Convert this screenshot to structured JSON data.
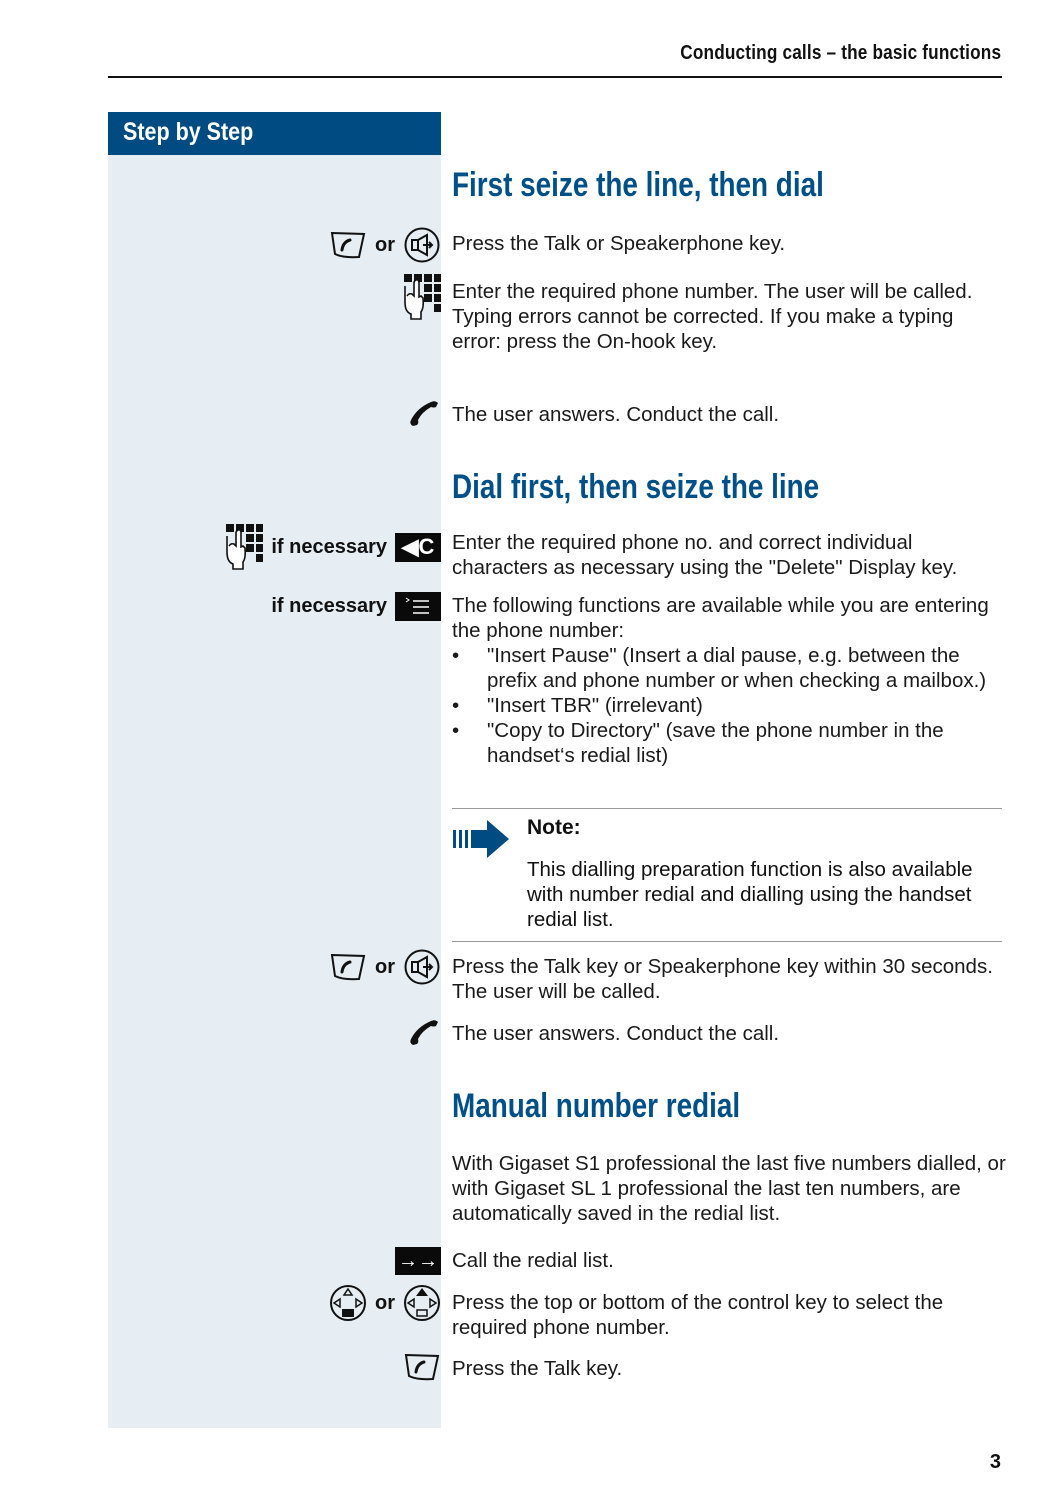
{
  "header": {
    "title": "Conducting calls – the basic functions"
  },
  "sidebar": {
    "title": "Step by Step"
  },
  "sections": [
    {
      "heading": "First seize the line, then dial",
      "steps": [
        {
          "icons": [
            "talk-key-icon",
            "speakerphone-key-icon"
          ],
          "connector": "or",
          "text": "Press the Talk or Speakerphone key."
        },
        {
          "icons": [
            "keypad-icon"
          ],
          "text_lines": [
            "Enter the required phone number. The user will be called.",
            "Typing errors cannot be corrected. If you make a typing error: press the On-hook key."
          ]
        },
        {
          "icons": [
            "handset-icon"
          ],
          "text": "The user answers. Conduct the call."
        }
      ]
    },
    {
      "heading": "Dial first, then seize the line",
      "steps": [
        {
          "icons": [
            "keypad-icon",
            "delete-key-icon"
          ],
          "label": "if necessary",
          "text": "Enter the required phone no. and correct individual characters as necessary using the \"Delete\" Display key."
        },
        {
          "icons": [
            "menu-key-icon"
          ],
          "label": "if necessary",
          "text": "The following functions are available while you are entering the phone number:",
          "bullets": [
            "\"Insert Pause\" (Insert a dial pause, e.g.  between the prefix and phone number or when checking a mailbox.)",
            "\"Insert TBR\" (irrelevant)",
            "\"Copy to Directory\" (save the phone number in the handset‘s redial list)"
          ]
        },
        {
          "icons": [
            "talk-key-icon",
            "speakerphone-key-icon"
          ],
          "connector": "or",
          "text": "Press the Talk key or Speakerphone key within 30 seconds. The user will be called."
        },
        {
          "icons": [
            "handset-icon"
          ],
          "text": "The user answers. Conduct the call."
        }
      ],
      "note": {
        "title": "Note:",
        "body": "This dialling preparation function is also available with number redial and dialling using the handset redial list."
      }
    },
    {
      "heading": "Manual number redial",
      "intro": "With Gigaset S1 professional the last five numbers dialled, or with Gigaset SL 1 professional the last ten numbers, are automatically saved in the redial list.",
      "steps": [
        {
          "icons": [
            "redial-key-icon"
          ],
          "key_glyph": "→→",
          "text": "Call the redial list."
        },
        {
          "icons": [
            "control-key-down-icon",
            "control-key-up-icon"
          ],
          "connector": "or",
          "text": "Press the top or bottom of the control key to select the required phone number."
        },
        {
          "icons": [
            "talk-key-icon"
          ],
          "text": "Press the Talk key."
        }
      ]
    }
  ],
  "page_number": "3",
  "colors": {
    "brand_blue": "#004c82",
    "heading_blue": "#005088",
    "sidebar_bg": "#e6eef3"
  }
}
